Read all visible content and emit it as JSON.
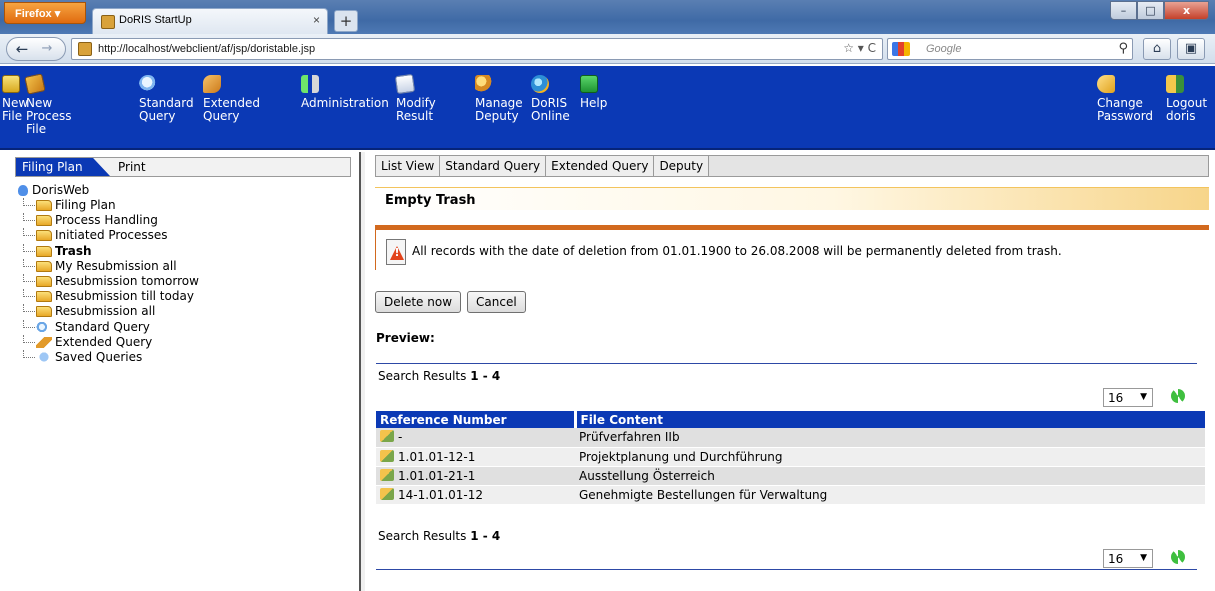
{
  "browser": {
    "menu_label": "Firefox ▾",
    "tab_title": "DoRIS StartUp",
    "tab_close": "×",
    "new_tab": "+",
    "url": "http://localhost/webclient/af/jsp/doristable.jsp",
    "url_actions": "☆ ▾ C",
    "search_placeholder": "Google",
    "window_controls": {
      "minimize": "–",
      "maximize": "□",
      "close": "x"
    }
  },
  "toolbar": {
    "items": [
      {
        "label": "New\nFile",
        "icon": "new-file-icon"
      },
      {
        "label": "New\nProcess\nFile",
        "icon": "new-process-icon"
      },
      {
        "label": "Standard\nQuery",
        "icon": "standard-query-icon"
      },
      {
        "label": "Extended\nQuery",
        "icon": "extended-query-icon"
      },
      {
        "label": "Administration",
        "icon": "administration-icon"
      },
      {
        "label": "Modify\nResult",
        "icon": "modify-result-icon"
      },
      {
        "label": "Manage\nDeputy",
        "icon": "deputy-icon"
      },
      {
        "label": "DoRIS\nOnline",
        "icon": "globe-icon"
      },
      {
        "label": "Help",
        "icon": "help-icon"
      },
      {
        "label": "Change\nPassword",
        "icon": "key-icon"
      },
      {
        "label": "Logout\ndoris",
        "icon": "logout-icon"
      }
    ]
  },
  "left_panel": {
    "tabs": [
      "Filing Plan",
      "Print"
    ],
    "tree_root": "DorisWeb",
    "tree_items": [
      "Filing Plan",
      "Process Handling",
      "Initiated Processes",
      "Trash",
      "My Resubmission all",
      "Resubmission tomorrow",
      "Resubmission till today",
      "Resubmission all",
      "Standard Query",
      "Extended Query",
      "Saved Queries"
    ]
  },
  "main": {
    "tabs": [
      "List View",
      "Standard Query",
      "Extended Query",
      "Deputy"
    ],
    "section_title": "Empty Trash",
    "warning_text": "All records with the date of deletion from 01.01.1900 to 26.08.2008 will be permanently deleted from trash.",
    "buttons": {
      "delete": "Delete now",
      "cancel": "Cancel"
    },
    "preview_label": "Preview:",
    "results": {
      "prefix": "Search Results ",
      "range": "1 - 4"
    },
    "page_size": "16",
    "table": {
      "headers": [
        "Reference Number",
        "File Content"
      ],
      "rows": [
        [
          "-",
          "Prüfverfahren IIb"
        ],
        [
          "1.01.01-12-1",
          "Projektplanung und Durchführung"
        ],
        [
          "1.01.01-21-1",
          "Ausstellung Österreich"
        ],
        [
          "14-1.01.01-12",
          "Genehmigte Bestellungen für Verwaltung"
        ]
      ]
    }
  }
}
